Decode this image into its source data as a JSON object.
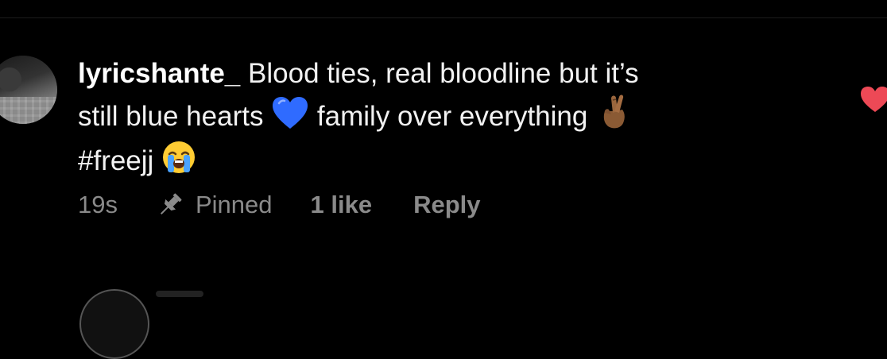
{
  "comment": {
    "username": "lyricshante_",
    "text_line1": "Blood ties, real bloodline but it’s",
    "text_line2a": "still blue hearts",
    "emoji_blue_heart": "💙",
    "text_line2b": "family over everything",
    "emoji_crossed_fingers": "🤞🏾",
    "hashtag": "#freejj",
    "emoji_crying": "😭",
    "time": "19s",
    "pinned_label": "Pinned",
    "likes": "1 like",
    "reply_label": "Reply"
  },
  "colors": {
    "background": "#000000",
    "text": "#ffffff",
    "meta_text": "#8a8a8a",
    "heart": "#ed4956",
    "blue_heart": "#2f6bff"
  },
  "icons": {
    "pin": "pin-icon",
    "heart": "heart-icon"
  }
}
